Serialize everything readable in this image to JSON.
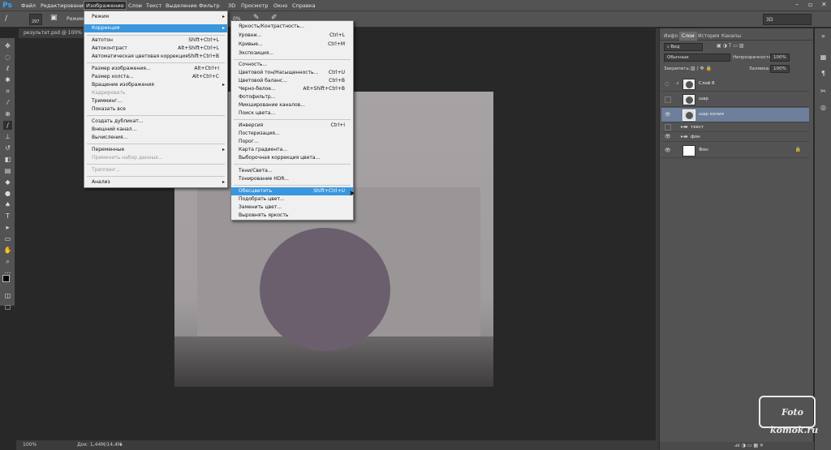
{
  "menubar": {
    "logo": "Ps",
    "items": [
      "Файл",
      "Редактирование",
      "Изображение",
      "Слои",
      "Текст",
      "Выделение",
      "Фильтр",
      "3D",
      "Просмотр",
      "Окно",
      "Справка"
    ],
    "active_index": 2
  },
  "options": {
    "brush_size": "297",
    "mode_label": "Режим",
    "percent": "0%",
    "workspace": "3D"
  },
  "document_tab": "результат.psd @ 100% (шар",
  "image_menu": {
    "items": [
      {
        "label": "Режим",
        "shortcut": "",
        "submenu": true
      },
      {
        "label": "Коррекция",
        "shortcut": "",
        "submenu": true,
        "highlight": true
      },
      {
        "label": "Автотон",
        "shortcut": "Shift+Ctrl+L"
      },
      {
        "label": "Автоконтраст",
        "shortcut": "Alt+Shift+Ctrl+L"
      },
      {
        "label": "Автоматическая цветовая коррекция",
        "shortcut": "Shift+Ctrl+B"
      },
      {
        "label": "Размер изображения...",
        "shortcut": "Alt+Ctrl+I"
      },
      {
        "label": "Размер холста...",
        "shortcut": "Alt+Ctrl+C"
      },
      {
        "label": "Вращение изображения",
        "shortcut": "",
        "submenu": true
      },
      {
        "label": "Кадрировать",
        "shortcut": "",
        "disabled": true
      },
      {
        "label": "Тримминг...",
        "shortcut": ""
      },
      {
        "label": "Показать все",
        "shortcut": ""
      },
      {
        "label": "Создать дубликат...",
        "shortcut": ""
      },
      {
        "label": "Внешний канал...",
        "shortcut": ""
      },
      {
        "label": "Вычисления...",
        "shortcut": ""
      },
      {
        "label": "Переменные",
        "shortcut": "",
        "submenu": true
      },
      {
        "label": "Применить набор данных...",
        "shortcut": "",
        "disabled": true
      },
      {
        "label": "Треппинг...",
        "shortcut": "",
        "disabled": true
      },
      {
        "label": "Анализ",
        "shortcut": "",
        "submenu": true
      }
    ]
  },
  "correction_menu": {
    "items": [
      {
        "label": "Яркость/Контрастность...",
        "shortcut": ""
      },
      {
        "label": "Уровни...",
        "shortcut": "Ctrl+L"
      },
      {
        "label": "Кривые...",
        "shortcut": "Ctrl+M"
      },
      {
        "label": "Экспозиция...",
        "shortcut": ""
      },
      {
        "label": "Сочность...",
        "shortcut": ""
      },
      {
        "label": "Цветовой тон/Насыщенность...",
        "shortcut": "Ctrl+U"
      },
      {
        "label": "Цветовой баланс...",
        "shortcut": "Ctrl+B"
      },
      {
        "label": "Черно-белое...",
        "shortcut": "Alt+Shift+Ctrl+B"
      },
      {
        "label": "Фотофильтр...",
        "shortcut": ""
      },
      {
        "label": "Микширование каналов...",
        "shortcut": ""
      },
      {
        "label": "Поиск цвета...",
        "shortcut": ""
      },
      {
        "label": "Инверсия",
        "shortcut": "Ctrl+I"
      },
      {
        "label": "Постеризация...",
        "shortcut": ""
      },
      {
        "label": "Порог...",
        "shortcut": ""
      },
      {
        "label": "Карта градиента...",
        "shortcut": ""
      },
      {
        "label": "Выборочная коррекция цвета...",
        "shortcut": ""
      },
      {
        "label": "Тени/Света...",
        "shortcut": ""
      },
      {
        "label": "Тонирование HDR...",
        "shortcut": ""
      },
      {
        "label": "Обесцветить",
        "shortcut": "Shift+Ctrl+U",
        "highlight": true
      },
      {
        "label": "Подобрать цвет...",
        "shortcut": ""
      },
      {
        "label": "Заменить цвет...",
        "shortcut": ""
      },
      {
        "label": "Выровнять яркость",
        "shortcut": ""
      }
    ]
  },
  "panel": {
    "tabs": [
      "Инфо",
      "Слои",
      "История",
      "Каналы"
    ],
    "active_tab": 1,
    "kind_label": "Вид",
    "blend_mode": "Обычные",
    "opacity_label": "Непрозрачность:",
    "opacity_value": "100%",
    "lock_label": "Закрепить:",
    "fill_label": "Заливка:",
    "fill_value": "100%",
    "layers": [
      {
        "name": "Слой 8",
        "visible": false,
        "type": "layer"
      },
      {
        "name": "шар",
        "visible": false,
        "type": "layer"
      },
      {
        "name": "шар копия",
        "visible": true,
        "type": "layer",
        "selected": true
      },
      {
        "name": "текст",
        "visible": false,
        "type": "folder"
      },
      {
        "name": "фон",
        "visible": true,
        "type": "folder"
      },
      {
        "name": "Фон",
        "visible": true,
        "type": "layer",
        "locked": true
      }
    ],
    "bottom_icons": "ⅎx ◑ ▭ ▦ ✕"
  },
  "status": {
    "zoom": "100%",
    "doc": "Док: 1,44M/14,4M"
  },
  "watermark": {
    "line1": "Foto",
    "line2": "komok.ru"
  },
  "colors": {
    "ui_gray": "#535353",
    "dark_bg": "#282828",
    "menu_highlight": "#3a96dd",
    "ball": "#6b5f6d",
    "selected_layer": "#6d7f9a"
  }
}
